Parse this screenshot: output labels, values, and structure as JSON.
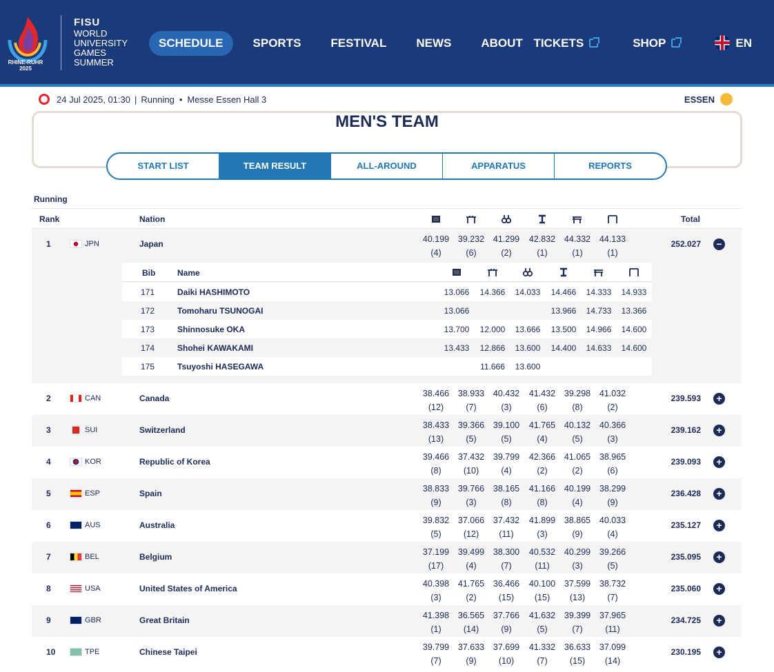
{
  "header": {
    "logo_line1": "FISU",
    "logo_lines": [
      "WORLD",
      "UNIVERSITY",
      "GAMES",
      "SUMMER"
    ],
    "logo_sub": "RHINE-RUHR",
    "logo_year": "2025",
    "nav_left": [
      "SCHEDULE",
      "SPORTS",
      "FESTIVAL",
      "NEWS",
      "ABOUT"
    ],
    "nav_active": "SCHEDULE",
    "tickets": "TICKETS",
    "shop": "SHOP",
    "lang": "EN"
  },
  "info": {
    "datetime": "24 Jul 2025, 01:30",
    "sep": "|",
    "state": "Running",
    "dot": "•",
    "venue": "Messe Essen Hall 3",
    "city": "ESSEN"
  },
  "title": "MEN'S TEAM",
  "tabs": [
    "START LIST",
    "TEAM RESULT",
    "ALL-AROUND",
    "APPARATUS",
    "REPORTS"
  ],
  "status_label": "Running",
  "columns": {
    "rank": "Rank",
    "nation": "Nation",
    "total": "Total",
    "bib": "Bib",
    "name": "Name"
  },
  "apparatus_icons": [
    "floor-icon",
    "pommel-horse-icon",
    "rings-icon",
    "vault-icon",
    "parallel-bars-icon",
    "high-bar-icon"
  ],
  "teams": [
    {
      "rank": "1",
      "code": "JPN",
      "nation": "Japan",
      "scores": [
        "40.199",
        "39.232",
        "41.299",
        "42.832",
        "44.332",
        "44.133"
      ],
      "places": [
        "(4)",
        "(6)",
        "(2)",
        "(1)",
        "(1)",
        "(1)"
      ],
      "total": "252.027",
      "expanded": true,
      "athletes": [
        {
          "bib": "171",
          "name": "Daiki HASHIMOTO",
          "scores": [
            "13.066",
            "14.366",
            "14.033",
            "14.466",
            "14.333",
            "14.933"
          ]
        },
        {
          "bib": "172",
          "name": "Tomoharu TSUNOGAI",
          "scores": [
            "13.066",
            "",
            "",
            "13.966",
            "14.733",
            "13.366"
          ]
        },
        {
          "bib": "173",
          "name": "Shinnosuke OKA",
          "scores": [
            "13.700",
            "12.000",
            "13.666",
            "13.500",
            "14.966",
            "14.600"
          ]
        },
        {
          "bib": "174",
          "name": "Shohei KAWAKAMI",
          "scores": [
            "13.433",
            "12.866",
            "13.600",
            "14.400",
            "14.633",
            "14.600"
          ]
        },
        {
          "bib": "175",
          "name": "Tsuyoshi HASEGAWA",
          "scores": [
            "",
            "11.666",
            "13.600",
            "",
            "",
            ""
          ]
        }
      ]
    },
    {
      "rank": "2",
      "code": "CAN",
      "nation": "Canada",
      "scores": [
        "38.466",
        "38.933",
        "40.432",
        "41.432",
        "39.298",
        "41.032"
      ],
      "places": [
        "(12)",
        "(7)",
        "(3)",
        "(6)",
        "(8)",
        "(2)"
      ],
      "total": "239.593"
    },
    {
      "rank": "3",
      "code": "SUI",
      "nation": "Switzerland",
      "scores": [
        "38.433",
        "39.366",
        "39.100",
        "41.765",
        "40.132",
        "40.366"
      ],
      "places": [
        "(13)",
        "(5)",
        "(5)",
        "(4)",
        "(5)",
        "(3)"
      ],
      "total": "239.162"
    },
    {
      "rank": "4",
      "code": "KOR",
      "nation": "Republic of Korea",
      "scores": [
        "39.466",
        "37.432",
        "39.799",
        "42.366",
        "41.065",
        "38.965"
      ],
      "places": [
        "(8)",
        "(10)",
        "(4)",
        "(2)",
        "(2)",
        "(6)"
      ],
      "total": "239.093"
    },
    {
      "rank": "5",
      "code": "ESP",
      "nation": "Spain",
      "scores": [
        "38.833",
        "39.766",
        "38.165",
        "41.166",
        "40.199",
        "38.299"
      ],
      "places": [
        "(9)",
        "(3)",
        "(8)",
        "(8)",
        "(4)",
        "(9)"
      ],
      "total": "236.428"
    },
    {
      "rank": "6",
      "code": "AUS",
      "nation": "Australia",
      "scores": [
        "39.832",
        "37.066",
        "37.432",
        "41.899",
        "38.865",
        "40.033"
      ],
      "places": [
        "(5)",
        "(12)",
        "(11)",
        "(3)",
        "(9)",
        "(4)"
      ],
      "total": "235.127"
    },
    {
      "rank": "7",
      "code": "BEL",
      "nation": "Belgium",
      "scores": [
        "37.199",
        "39.499",
        "38.300",
        "40.532",
        "40.299",
        "39.266"
      ],
      "places": [
        "(17)",
        "(4)",
        "(7)",
        "(11)",
        "(3)",
        "(5)"
      ],
      "total": "235.095"
    },
    {
      "rank": "8",
      "code": "USA",
      "nation": "United States of America",
      "scores": [
        "40.398",
        "41.765",
        "36.466",
        "40.100",
        "37.599",
        "38.732"
      ],
      "places": [
        "(3)",
        "(2)",
        "(15)",
        "(15)",
        "(13)",
        "(7)"
      ],
      "total": "235.060"
    },
    {
      "rank": "9",
      "code": "GBR",
      "nation": "Great Britain",
      "scores": [
        "41.398",
        "36.565",
        "37.766",
        "41.632",
        "39.399",
        "37.965"
      ],
      "places": [
        "(1)",
        "(14)",
        "(9)",
        "(5)",
        "(7)",
        "(11)"
      ],
      "total": "234.725"
    },
    {
      "rank": "10",
      "code": "TPE",
      "nation": "Chinese Taipei",
      "scores": [
        "39.799",
        "37.633",
        "37.699",
        "41.332",
        "36.633",
        "37.099"
      ],
      "places": [
        "(7)",
        "(9)",
        "(10)",
        "(7)",
        "(15)",
        "(14)"
      ],
      "total": "230.195"
    }
  ],
  "colors": {
    "header_bg": "#1b3a7a",
    "accent": "#2277b5",
    "live": "#e0262f",
    "text": "#1b2a57"
  }
}
